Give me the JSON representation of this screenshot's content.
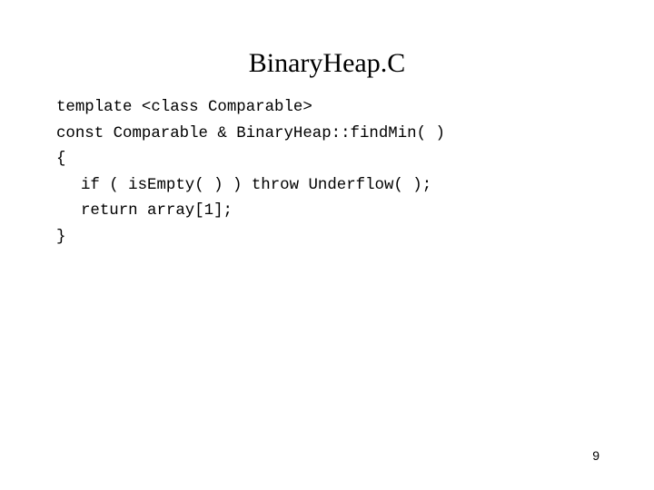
{
  "slide": {
    "title": "BinaryHeap.C",
    "code_lines": [
      {
        "text": "template <class Comparable>",
        "indent": false
      },
      {
        "text": "const Comparable & BinaryHeap::findMin( )",
        "indent": false
      },
      {
        "text": "{",
        "indent": false
      },
      {
        "text": "if ( isEmpty( ) ) throw Underflow( );",
        "indent": true
      },
      {
        "text": "return array[1];",
        "indent": true
      },
      {
        "text": "}",
        "indent": false
      }
    ],
    "page_number": "9"
  }
}
